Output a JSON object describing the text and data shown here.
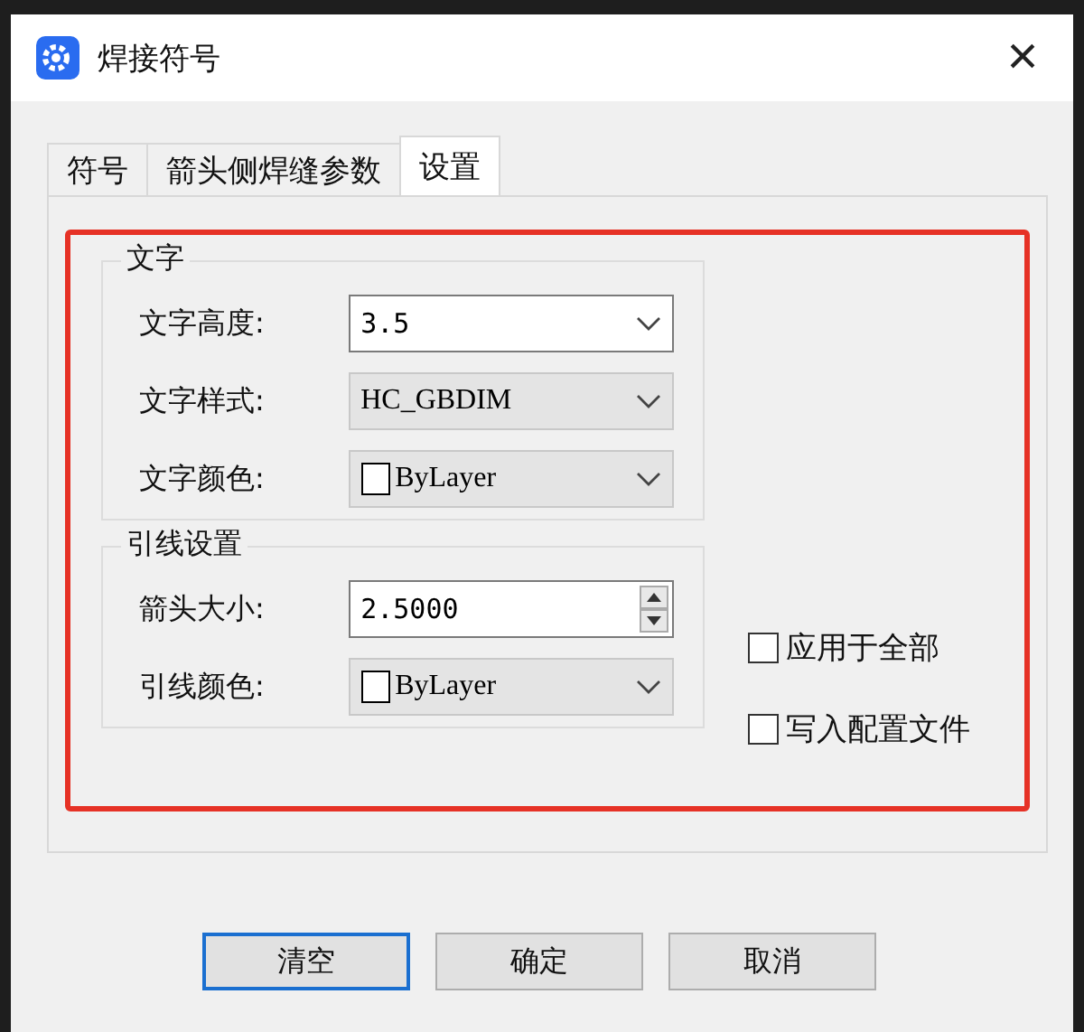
{
  "window": {
    "title": "焊接符号",
    "close": "×"
  },
  "tabs": [
    {
      "label": "符号",
      "selected": false
    },
    {
      "label": "箭头侧焊缝参数",
      "selected": false
    },
    {
      "label": "设置",
      "selected": true
    }
  ],
  "groups": [
    {
      "title": "文字",
      "fields": [
        {
          "label": "文字高度:",
          "kind": "edit-combo",
          "value": "3.5"
        },
        {
          "label": "文字样式:",
          "kind": "combo",
          "value": "HC_GBDIM"
        },
        {
          "label": "文字颜色:",
          "kind": "color-combo",
          "value": "ByLayer"
        }
      ]
    },
    {
      "title": "引线设置",
      "fields": [
        {
          "label": "箭头大小:",
          "kind": "spin",
          "value": "2.5000"
        },
        {
          "label": "引线颜色:",
          "kind": "color-combo",
          "value": "ByLayer"
        }
      ]
    }
  ],
  "checkboxes": [
    {
      "label": "应用于全部",
      "checked": false
    },
    {
      "label": "写入配置文件",
      "checked": false
    }
  ],
  "buttons": [
    {
      "label": "清空",
      "default": true
    },
    {
      "label": "确定",
      "default": false
    },
    {
      "label": "取消",
      "default": false
    }
  ]
}
